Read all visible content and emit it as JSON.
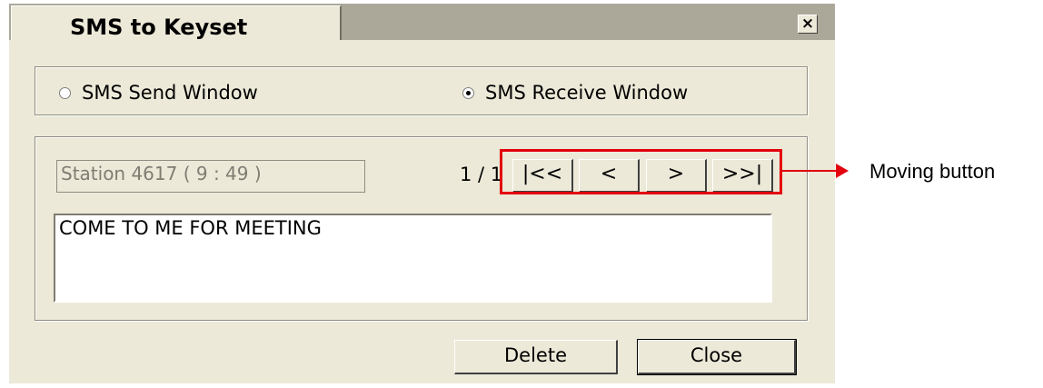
{
  "dialog": {
    "title": "SMS to Keyset",
    "close_glyph": "×",
    "mode": {
      "send_label": "SMS Send Window",
      "receive_label": "SMS Receive Window",
      "selected": "receive"
    },
    "station": "Station 4617  ( 9 : 49 )",
    "counter": "1 / 1",
    "nav": {
      "first": "|<<",
      "prev": "<",
      "next": ">",
      "last": ">>|"
    },
    "message": "COME TO ME FOR MEETING",
    "delete_label": "Delete",
    "close_label": "Close"
  },
  "annotation": {
    "label": "Moving button",
    "color": "#e3000f"
  }
}
